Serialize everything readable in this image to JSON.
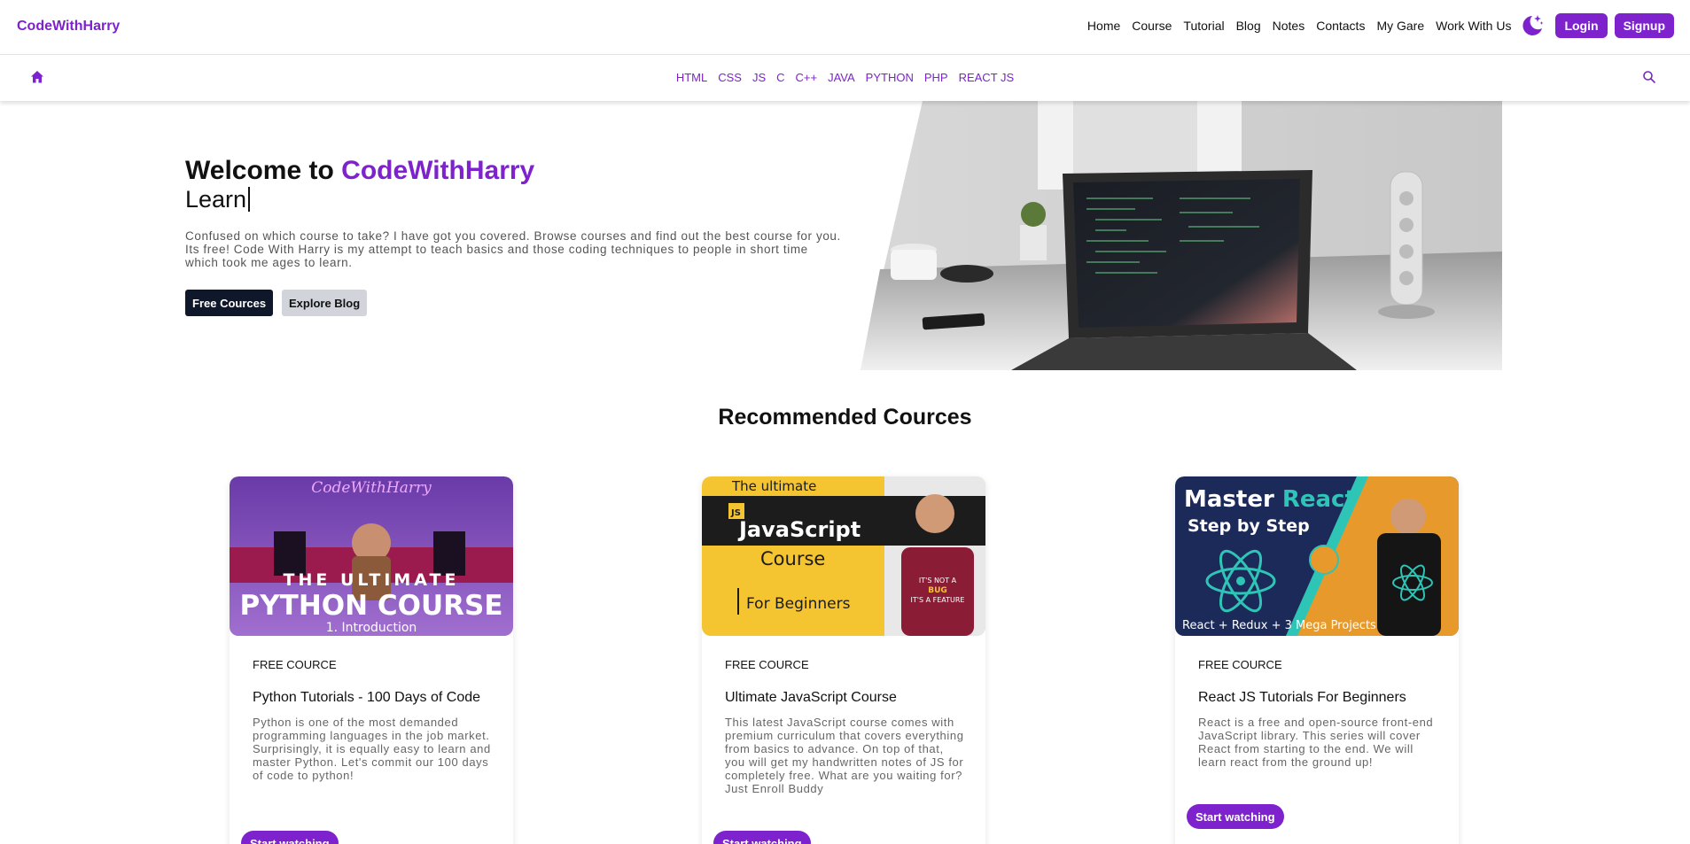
{
  "brand": "CodeWithHarry",
  "topnav": {
    "links": [
      "Home",
      "Course",
      "Tutorial",
      "Blog",
      "Notes",
      "Contacts",
      "My Gare",
      "Work With Us"
    ],
    "login_label": "Login",
    "signup_label": "Signup"
  },
  "subnav": {
    "languages": [
      "HTML",
      "CSS",
      "JS",
      "C",
      "C++",
      "JAVA",
      "PYTHON",
      "PHP",
      "REACT JS"
    ]
  },
  "hero": {
    "title_prefix": "Welcome to ",
    "title_accent": "CodeWithHarry",
    "subtitle": "Learn",
    "description": "Confused on which course to take? I have got you covered. Browse courses and find out the best course for you. Its free! Code With Harry is my attempt to teach basics and those coding techniques to people in short time which took me ages to learn.",
    "primary_button": "Free Cources",
    "secondary_button": "Explore Blog"
  },
  "section_title": "Recommended Cources",
  "courses": [
    {
      "tag": "FREE COURCE",
      "title": "Python Tutorials - 100 Days of Code",
      "description": "Python is one of the most demanded programming languages in the job market. Surprisingly, it is equally easy to learn and master Python. Let's commit our 100 days of code to python!",
      "button": "Start watching",
      "thumb": {
        "logo": "CodeWithHarry",
        "line1": "THE ULTIMATE",
        "line2": "PYTHON COURSE",
        "line3": "1. Introduction"
      }
    },
    {
      "tag": "FREE COURCE",
      "title": "Ultimate JavaScript Course",
      "description": "This latest JavaScript course comes with premium curriculum that covers everything from basics to advance. On top of that, you will get my handwritten notes of JS for completely free. What are you waiting for? Just Enroll Buddy",
      "button": "Start watching",
      "thumb": {
        "line1": "The ultimate",
        "badge": "JS",
        "line2": "JavaScript",
        "line3": "Course",
        "line4": "For Beginners",
        "shirt1": "IT'S NOT A",
        "shirt2": "BUG",
        "shirt3": "IT'S A FEATURE"
      }
    },
    {
      "tag": "FREE COURCE",
      "title": "React JS Tutorials For Beginners",
      "description": "React is a free and open-source front-end JavaScript library. This series will cover React from starting to the end. We will learn react from the ground up!",
      "button": "Start watching",
      "thumb": {
        "line1a": "Master ",
        "line1b": "React",
        "line2": "Step by Step",
        "line3": "React + Redux + 3 Mega Projects"
      }
    }
  ],
  "colors": {
    "accent": "#7e22ce",
    "dark_button": "#0f172a",
    "gray_button": "#d1d5db"
  },
  "icons": [
    "moon-stars-icon",
    "home-icon",
    "search-icon"
  ]
}
